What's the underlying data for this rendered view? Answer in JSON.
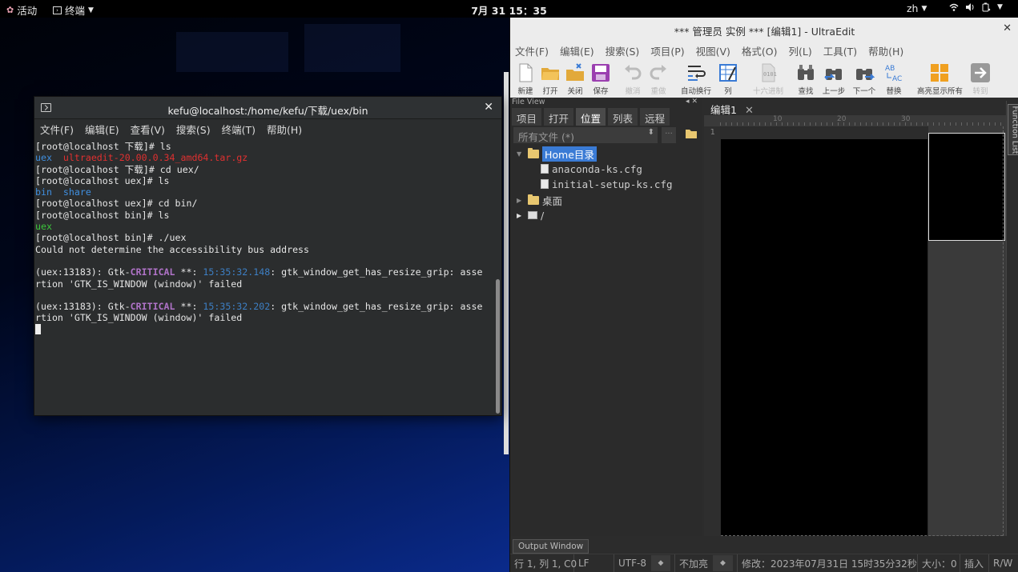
{
  "topbar": {
    "activities": "活动",
    "app_menu": "终端",
    "clock": "7月 31  15：35",
    "lang": "zh"
  },
  "terminal": {
    "title": "kefu@localhost:/home/kefu/下载/uex/bin",
    "menu": [
      "文件(F)",
      "编辑(E)",
      "查看(V)",
      "搜索(S)",
      "终端(T)",
      "帮助(H)"
    ],
    "lines": {
      "l1": "[root@localhost 下载]# ls",
      "l2a": "uex",
      "l2b": "ultraedit-20.00.0.34_amd64.tar.gz",
      "l3": "[root@localhost 下载]# cd uex/",
      "l4": "[root@localhost uex]# ls",
      "l5a": "bin",
      "l5b": "share",
      "l6": "[root@localhost uex]# cd bin/",
      "l7": "[root@localhost bin]# ls",
      "l8": "uex",
      "l9": "[root@localhost bin]# ./uex",
      "l10": "Could not determine the accessibility bus address",
      "e1_pre": "(uex:13183): Gtk-",
      "e1_crit": "CRITICAL",
      "e1_mid": " **: ",
      "e1_ts": "15:35:32.148",
      "e1_post": ": gtk_window_get_has_resize_grip: asse",
      "e1_wrap": "rtion 'GTK_IS_WINDOW (window)' failed",
      "e2_pre": "(uex:13183): Gtk-",
      "e2_crit": "CRITICAL",
      "e2_mid": " **: ",
      "e2_ts": "15:35:32.202",
      "e2_post": ": gtk_window_get_has_resize_grip: asse",
      "e2_wrap": "rtion 'GTK_IS_WINDOW (window)' failed"
    }
  },
  "ultraedit": {
    "title": "*** 管理员 实例 ***  [编辑1] - UltraEdit",
    "menu": [
      "文件(F)",
      "编辑(E)",
      "搜索(S)",
      "项目(P)",
      "视图(V)",
      "格式(O)",
      "列(L)",
      "工具(T)",
      "帮助(H)"
    ],
    "toolbar": {
      "new": "新建",
      "open": "打开",
      "close": "关闭",
      "save": "保存",
      "undo": "撤消",
      "redo": "重做",
      "wrap": "自动换行",
      "column": "列",
      "hex": "十六进制",
      "find": "查找",
      "prev": "上一步",
      "next": "下一个",
      "replace": "替换",
      "highlight": "高亮显示所有",
      "goto": "转到"
    },
    "fileview": {
      "header": "File View",
      "tabs": [
        "项目",
        "打开",
        "位置",
        "列表",
        "远程"
      ],
      "active_tab": "位置",
      "filter": "所有文件 (*)",
      "filter_dots": "...",
      "tree": {
        "home": "Home目录",
        "file1": "anaconda-ks.cfg",
        "file2": "initial-setup-ks.cfg",
        "desktop": "桌面",
        "root": "/"
      }
    },
    "editor": {
      "tab": "编辑1",
      "ruler": {
        "m10": "10",
        "m20": "20",
        "m30": "30"
      },
      "line1": "1"
    },
    "function_list": "Function List",
    "output_tab": "Output Window",
    "status": {
      "pos": "行 1, 列 1, C0",
      "eol": "LF",
      "enc": "UTF-8",
      "hl": "不加亮",
      "modified": "修改：2023年07月31日 15时35分32秒",
      "size": "大小：0",
      "mode": "插入",
      "rw": "R/W"
    }
  }
}
